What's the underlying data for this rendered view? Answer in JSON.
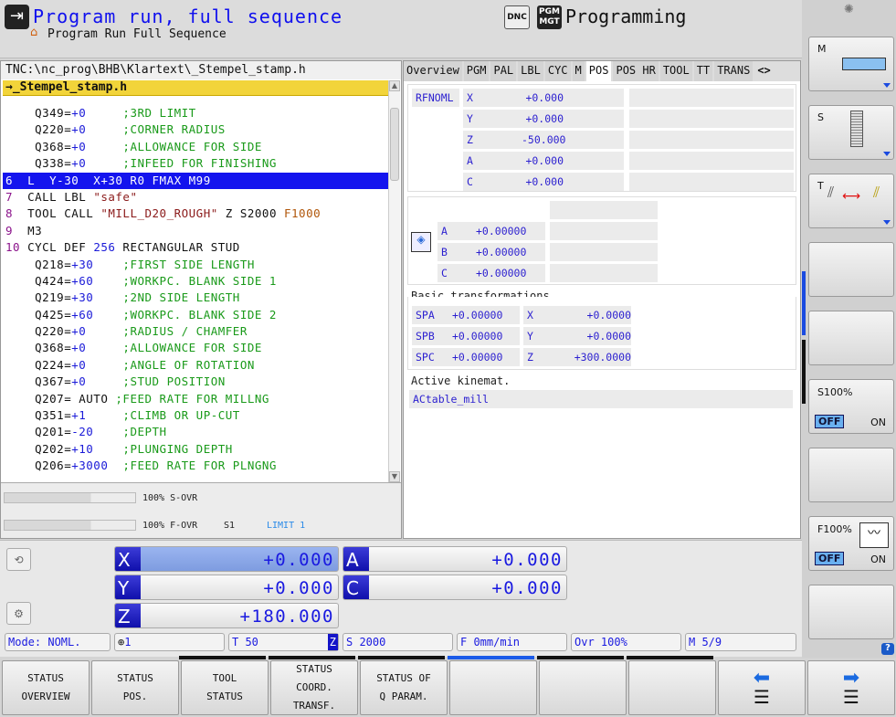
{
  "header": {
    "title": "Program run, full sequence",
    "subtitle": "Program Run Full Sequence",
    "dnc_label": "DNC",
    "pgm_mgt_label": "PGM MGT",
    "programming_label": "Programming"
  },
  "program": {
    "path": "TNC:\\nc_prog\\BHB\\Klartext\\_Stempel_stamp.h",
    "file": "→_Stempel_stamp.h",
    "selected_line": 4,
    "lines": [
      [
        {
          "t": "    Q349=",
          "c": "k"
        },
        {
          "t": "+0     ",
          "c": "v"
        },
        {
          "t": ";3RD LIMIT",
          "c": "cm"
        }
      ],
      [
        {
          "t": "    Q220=",
          "c": "k"
        },
        {
          "t": "+0     ",
          "c": "v"
        },
        {
          "t": ";CORNER RADIUS",
          "c": "cm"
        }
      ],
      [
        {
          "t": "    Q368=",
          "c": "k"
        },
        {
          "t": "+0     ",
          "c": "v"
        },
        {
          "t": ";ALLOWANCE FOR SIDE",
          "c": "cm"
        }
      ],
      [
        {
          "t": "    Q338=",
          "c": "k"
        },
        {
          "t": "+0     ",
          "c": "v"
        },
        {
          "t": ";INFEED FOR FINISHING",
          "c": "cm"
        }
      ],
      [
        {
          "t": "6  ",
          "c": "num"
        },
        {
          "t": "L  Y-30  X+30 R0 FMAX M99",
          "c": "k"
        }
      ],
      [
        {
          "t": "7  ",
          "c": "num"
        },
        {
          "t": "CALL LBL ",
          "c": "k"
        },
        {
          "t": "\"safe\"",
          "c": "s"
        }
      ],
      [
        {
          "t": "8  ",
          "c": "num"
        },
        {
          "t": "TOOL CALL ",
          "c": "k"
        },
        {
          "t": "\"MILL_D20_ROUGH\"",
          "c": "s"
        },
        {
          "t": " Z S2000 ",
          "c": "k"
        },
        {
          "t": "F1000",
          "c": "f"
        }
      ],
      [
        {
          "t": "9  ",
          "c": "num"
        },
        {
          "t": "M3",
          "c": "k"
        }
      ],
      [
        {
          "t": "10 ",
          "c": "num"
        },
        {
          "t": "CYCL DEF ",
          "c": "k"
        },
        {
          "t": "256",
          "c": "v"
        },
        {
          "t": " RECTANGULAR STUD",
          "c": "k"
        }
      ],
      [
        {
          "t": "    Q218=",
          "c": "k"
        },
        {
          "t": "+30    ",
          "c": "v"
        },
        {
          "t": ";FIRST SIDE LENGTH",
          "c": "cm"
        }
      ],
      [
        {
          "t": "    Q424=",
          "c": "k"
        },
        {
          "t": "+60    ",
          "c": "v"
        },
        {
          "t": ";WORKPC. BLANK SIDE 1",
          "c": "cm"
        }
      ],
      [
        {
          "t": "    Q219=",
          "c": "k"
        },
        {
          "t": "+30    ",
          "c": "v"
        },
        {
          "t": ";2ND SIDE LENGTH",
          "c": "cm"
        }
      ],
      [
        {
          "t": "    Q425=",
          "c": "k"
        },
        {
          "t": "+60    ",
          "c": "v"
        },
        {
          "t": ";WORKPC. BLANK SIDE 2",
          "c": "cm"
        }
      ],
      [
        {
          "t": "    Q220=",
          "c": "k"
        },
        {
          "t": "+0     ",
          "c": "v"
        },
        {
          "t": ";RADIUS / CHAMFER",
          "c": "cm"
        }
      ],
      [
        {
          "t": "    Q368=",
          "c": "k"
        },
        {
          "t": "+0     ",
          "c": "v"
        },
        {
          "t": ";ALLOWANCE FOR SIDE",
          "c": "cm"
        }
      ],
      [
        {
          "t": "    Q224=",
          "c": "k"
        },
        {
          "t": "+0     ",
          "c": "v"
        },
        {
          "t": ";ANGLE OF ROTATION",
          "c": "cm"
        }
      ],
      [
        {
          "t": "    Q367=",
          "c": "k"
        },
        {
          "t": "+0     ",
          "c": "v"
        },
        {
          "t": ";STUD POSITION",
          "c": "cm"
        }
      ],
      [
        {
          "t": "    Q207= AUTO ",
          "c": "k"
        },
        {
          "t": ";FEED RATE FOR MILLNG",
          "c": "cm"
        }
      ],
      [
        {
          "t": "    Q351=",
          "c": "k"
        },
        {
          "t": "+1     ",
          "c": "v"
        },
        {
          "t": ";CLIMB OR UP-CUT",
          "c": "cm"
        }
      ],
      [
        {
          "t": "    Q201=",
          "c": "k"
        },
        {
          "t": "-20    ",
          "c": "v"
        },
        {
          "t": ";DEPTH",
          "c": "cm"
        }
      ],
      [
        {
          "t": "    Q202=",
          "c": "k"
        },
        {
          "t": "+10    ",
          "c": "v"
        },
        {
          "t": ";PLUNGING DEPTH",
          "c": "cm"
        }
      ],
      [
        {
          "t": "    Q206=",
          "c": "k"
        },
        {
          "t": "+3000  ",
          "c": "v"
        },
        {
          "t": ";FEED RATE FOR PLNGNG",
          "c": "cm"
        }
      ]
    ]
  },
  "overrides": {
    "s_ovr": "100% S-OVR",
    "f_ovr": "100% F-OVR",
    "s1": "S1",
    "limit": "LIMIT 1",
    "s_ovr_percent": 100,
    "f_ovr_percent": 100
  },
  "status": {
    "tabs": [
      "Overview",
      "PGM",
      "PAL",
      "LBL",
      "CYC",
      "M",
      "POS",
      "POS HR",
      "TOOL",
      "TT",
      "TRANS"
    ],
    "active_tab": "POS",
    "tab_nav": "<>",
    "rfnoml": "RFNOML",
    "pos": [
      {
        "axis": "X",
        "value": "+0.000"
      },
      {
        "axis": "Y",
        "value": "+0.000"
      },
      {
        "axis": "Z",
        "value": "-50.000"
      },
      {
        "axis": "A",
        "value": "+0.000"
      },
      {
        "axis": "C",
        "value": "+0.000"
      }
    ],
    "rot": [
      {
        "axis": "A",
        "value": "+0.00000"
      },
      {
        "axis": "B",
        "value": "+0.00000"
      },
      {
        "axis": "C",
        "value": "+0.00000"
      }
    ],
    "basic_title": "Basic transformations",
    "basic": [
      {
        "a": "SPA",
        "av": "+0.00000",
        "b": "X",
        "bv": "+0.0000"
      },
      {
        "a": "SPB",
        "av": "+0.00000",
        "b": "Y",
        "bv": "+0.0000"
      },
      {
        "a": "SPC",
        "av": "+0.00000",
        "b": "Z",
        "bv": "+300.0000"
      }
    ],
    "kin_title": "Active kinemat.",
    "kin_value": "ACtable_mill"
  },
  "position": {
    "axes": [
      {
        "axis": "X",
        "value": "+0.000"
      },
      {
        "axis": "Y",
        "value": "+0.000"
      },
      {
        "axis": "Z",
        "value": "+180.000"
      },
      {
        "axis": "A",
        "value": "+0.000"
      },
      {
        "axis": "C",
        "value": "+0.000"
      }
    ],
    "mode": "Mode: NOML.",
    "datum": "1",
    "tool": "T 50",
    "tool_axis": "Z",
    "spindle": "S 2000",
    "feed": "F 0mm/min",
    "ovr": "Ovr 100%",
    "m": "M 5/9"
  },
  "softkeys": [
    [
      "STATUS",
      "OVERVIEW"
    ],
    [
      "STATUS",
      "POS."
    ],
    [
      "TOOL",
      "STATUS"
    ],
    [
      "STATUS",
      "COORD.",
      "TRANSF."
    ],
    [
      "STATUS OF",
      "Q PARAM."
    ],
    [],
    [],
    []
  ],
  "side": {
    "m": "M",
    "s": "S",
    "t": "T",
    "s100": "S100%",
    "f100": "F100%",
    "off": "OFF",
    "on": "ON"
  },
  "colors": {
    "accent": "#1414ee",
    "file_bar": "#f2d43a",
    "comment": "#1a9a1a"
  }
}
